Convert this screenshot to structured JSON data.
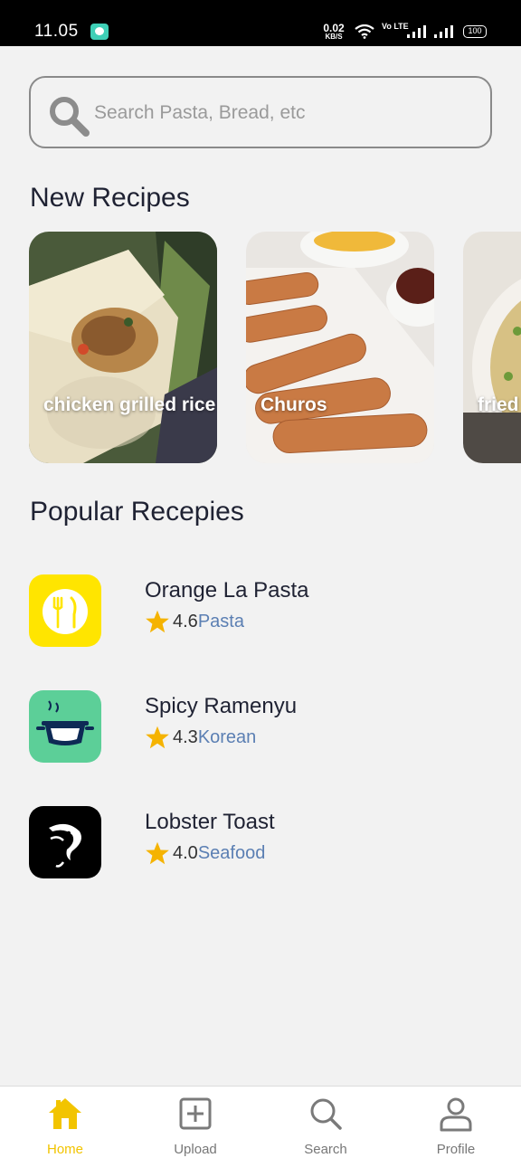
{
  "status_bar": {
    "time": "11.05",
    "net_speed": "0.02",
    "net_speed_unit": "KB/S",
    "volte": "Vo LTE",
    "battery": "100"
  },
  "search": {
    "placeholder": "Search Pasta, Bread, etc"
  },
  "new_recipes": {
    "title": "New Recipes",
    "items": [
      {
        "label": "chicken grilled rice"
      },
      {
        "label": "Churos"
      },
      {
        "label": "fried"
      }
    ]
  },
  "popular": {
    "title": "Popular Recepies",
    "items": [
      {
        "name": "Orange La Pasta",
        "rating": "4.6",
        "category": "Pasta",
        "icon": "plate-cutlery-icon",
        "color": "#ffe500"
      },
      {
        "name": "Spicy Ramenyu",
        "rating": "4.3",
        "category": "Korean",
        "icon": "cooking-pot-icon",
        "color": "#5ccf98"
      },
      {
        "name": "Lobster Toast",
        "rating": "4.0",
        "category": "Seafood",
        "icon": "fish-icon",
        "color": "#000000"
      }
    ]
  },
  "bottom_nav": {
    "items": [
      {
        "label": "Home",
        "icon": "home-icon",
        "active": true
      },
      {
        "label": "Upload",
        "icon": "plus-square-icon",
        "active": false
      },
      {
        "label": "Search",
        "icon": "search-icon",
        "active": false
      },
      {
        "label": "Profile",
        "icon": "user-icon",
        "active": false
      }
    ]
  },
  "colors": {
    "accent": "#f2c400",
    "category_text": "#5b7fb3",
    "star": "#f5b301",
    "background": "#f2f2f2"
  }
}
